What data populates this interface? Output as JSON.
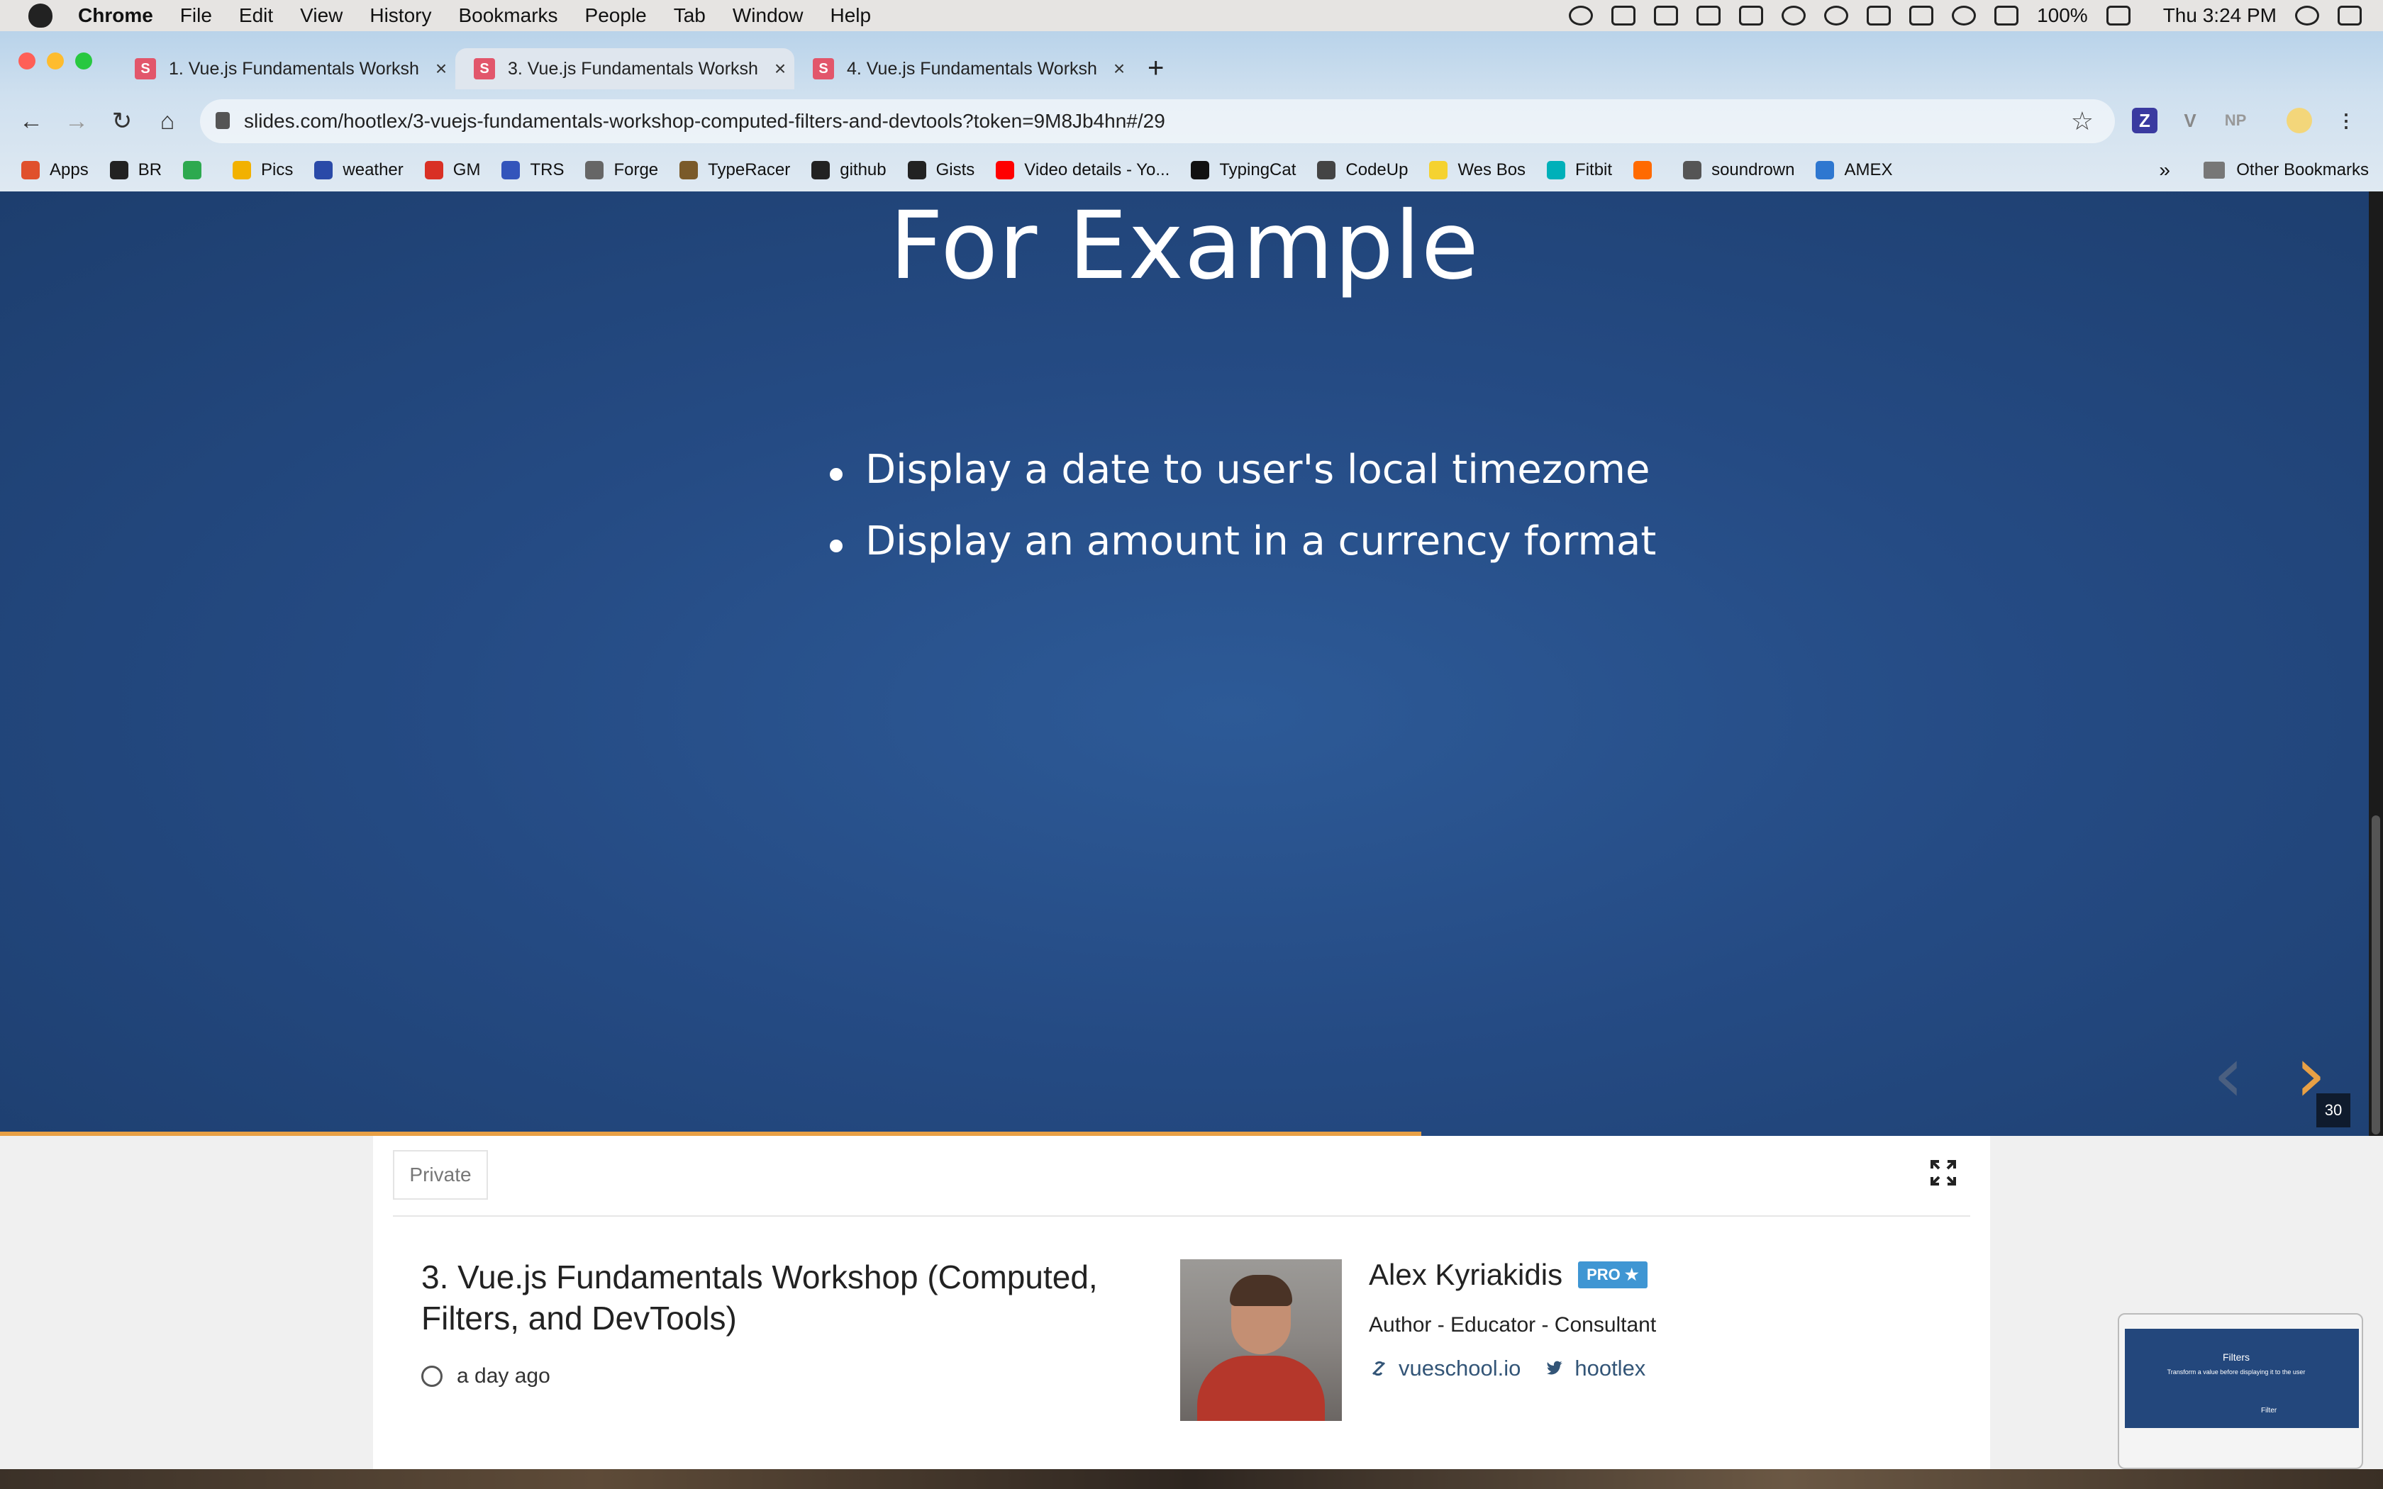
{
  "menubar": {
    "app": "Chrome",
    "items": [
      "File",
      "Edit",
      "View",
      "History",
      "Bookmarks",
      "People",
      "Tab",
      "Window",
      "Help"
    ],
    "battery": "100%",
    "clock": "Thu 3:24 PM"
  },
  "tabs": [
    {
      "label": "1. Vue.js Fundamentals Worksh",
      "favicon": "S",
      "active": false
    },
    {
      "label": "3. Vue.js Fundamentals Worksh",
      "favicon": "S",
      "active": true
    },
    {
      "label": "4. Vue.js Fundamentals Worksh",
      "favicon": "S",
      "active": false
    }
  ],
  "omnibox": {
    "url": "slides.com/hootlex/3-vuejs-fundamentals-workshop-computed-filters-and-devtools?token=9M8Jb4hn#/29"
  },
  "extensions": [
    "Z",
    "V",
    "NP"
  ],
  "bookmarks": [
    {
      "label": "Apps",
      "color": "#e0502c"
    },
    {
      "label": "BR",
      "color": "#222222"
    },
    {
      "label": "",
      "color": "#2da94f"
    },
    {
      "label": "Pics",
      "color": "#f2b100"
    },
    {
      "label": "weather",
      "color": "#2a4aa8"
    },
    {
      "label": "GM",
      "color": "#d93025"
    },
    {
      "label": "TRS",
      "color": "#3355bb"
    },
    {
      "label": "Forge",
      "color": "#666666"
    },
    {
      "label": "TypeRacer",
      "color": "#7a5a2a"
    },
    {
      "label": "github",
      "color": "#222222"
    },
    {
      "label": "Gists",
      "color": "#222222"
    },
    {
      "label": "Video details - Yo...",
      "color": "#ff0000"
    },
    {
      "label": "TypingCat",
      "color": "#111111"
    },
    {
      "label": "CodeUp",
      "color": "#444444"
    },
    {
      "label": "Wes Bos",
      "color": "#f5d230"
    },
    {
      "label": "Fitbit",
      "color": "#00b0b9"
    },
    {
      "label": "",
      "color": "#ff6a00"
    },
    {
      "label": "soundrown",
      "color": "#555555"
    },
    {
      "label": "AMEX",
      "color": "#2e77d0"
    }
  ],
  "bookmarks_overflow": "»",
  "other_bookmarks": "Other Bookmarks",
  "slide": {
    "title": "For Example",
    "bullets": [
      "Display a date to user's local timezome",
      "Display an amount in a currency format"
    ],
    "number": "30",
    "progress": 0.6,
    "prev_arrow_color": "#4a5f80",
    "next_arrow_color": "#e8a045"
  },
  "deck": {
    "visibility": "Private",
    "title": "3. Vue.js Fundamentals Workshop (Computed, Filters, and DevTools)",
    "date": "a day ago"
  },
  "author": {
    "name": "Alex Kyriakidis",
    "badge": "PRO ★",
    "role": "Author - Educator - Consultant",
    "website": "vueschool.io",
    "twitter": "hootlex"
  },
  "pip": {
    "title": "Filters",
    "subtitle": "Transform a value before displaying it to the user",
    "label": "Filter"
  }
}
